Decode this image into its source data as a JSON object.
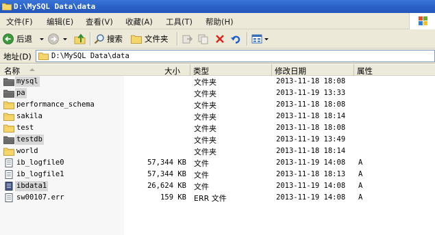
{
  "window": {
    "title": "D:\\MySQL Data\\data"
  },
  "menu": [
    "文件(F)",
    "编辑(E)",
    "查看(V)",
    "收藏(A)",
    "工具(T)",
    "帮助(H)"
  ],
  "toolbar": {
    "back_label": "后退",
    "search_label": "搜索",
    "folders_label": "文件夹"
  },
  "address": {
    "label": "地址(D)",
    "value": "D:\\MySQL Data\\data"
  },
  "columns": {
    "name": "名称",
    "size": "大小",
    "type": "类型",
    "modified": "修改日期",
    "attributes": "属性"
  },
  "files": [
    {
      "name": "mysql",
      "size": "",
      "type": "文件夹",
      "modified": "2013-11-18 18:08",
      "attr": "",
      "kind": "folder-dark",
      "highlight": true
    },
    {
      "name": "pa",
      "size": "",
      "type": "文件夹",
      "modified": "2013-11-19 13:33",
      "attr": "",
      "kind": "folder-dark",
      "highlight": true
    },
    {
      "name": "performance_schema",
      "size": "",
      "type": "文件夹",
      "modified": "2013-11-18 18:08",
      "attr": "",
      "kind": "folder",
      "highlight": false
    },
    {
      "name": "sakila",
      "size": "",
      "type": "文件夹",
      "modified": "2013-11-18 18:14",
      "attr": "",
      "kind": "folder",
      "highlight": false
    },
    {
      "name": "test",
      "size": "",
      "type": "文件夹",
      "modified": "2013-11-18 18:08",
      "attr": "",
      "kind": "folder",
      "highlight": false
    },
    {
      "name": "testdb",
      "size": "",
      "type": "文件夹",
      "modified": "2013-11-19 13:49",
      "attr": "",
      "kind": "folder-dark",
      "highlight": true
    },
    {
      "name": "world",
      "size": "",
      "type": "文件夹",
      "modified": "2013-11-18 18:14",
      "attr": "",
      "kind": "folder",
      "highlight": false
    },
    {
      "name": "ib_logfile0",
      "size": "57,344 KB",
      "type": "文件",
      "modified": "2013-11-19 14:08",
      "attr": "A",
      "kind": "file",
      "highlight": false
    },
    {
      "name": "ib_logfile1",
      "size": "57,344 KB",
      "type": "文件",
      "modified": "2013-11-18 18:13",
      "attr": "A",
      "kind": "file",
      "highlight": false
    },
    {
      "name": "ibdata1",
      "size": "26,624 KB",
      "type": "文件",
      "modified": "2013-11-19 14:08",
      "attr": "A",
      "kind": "file-dark",
      "highlight": true
    },
    {
      "name": "sw00107.err",
      "size": "159 KB",
      "type": "ERR 文件",
      "modified": "2013-11-19 14:08",
      "attr": "A",
      "kind": "file",
      "highlight": false
    }
  ]
}
